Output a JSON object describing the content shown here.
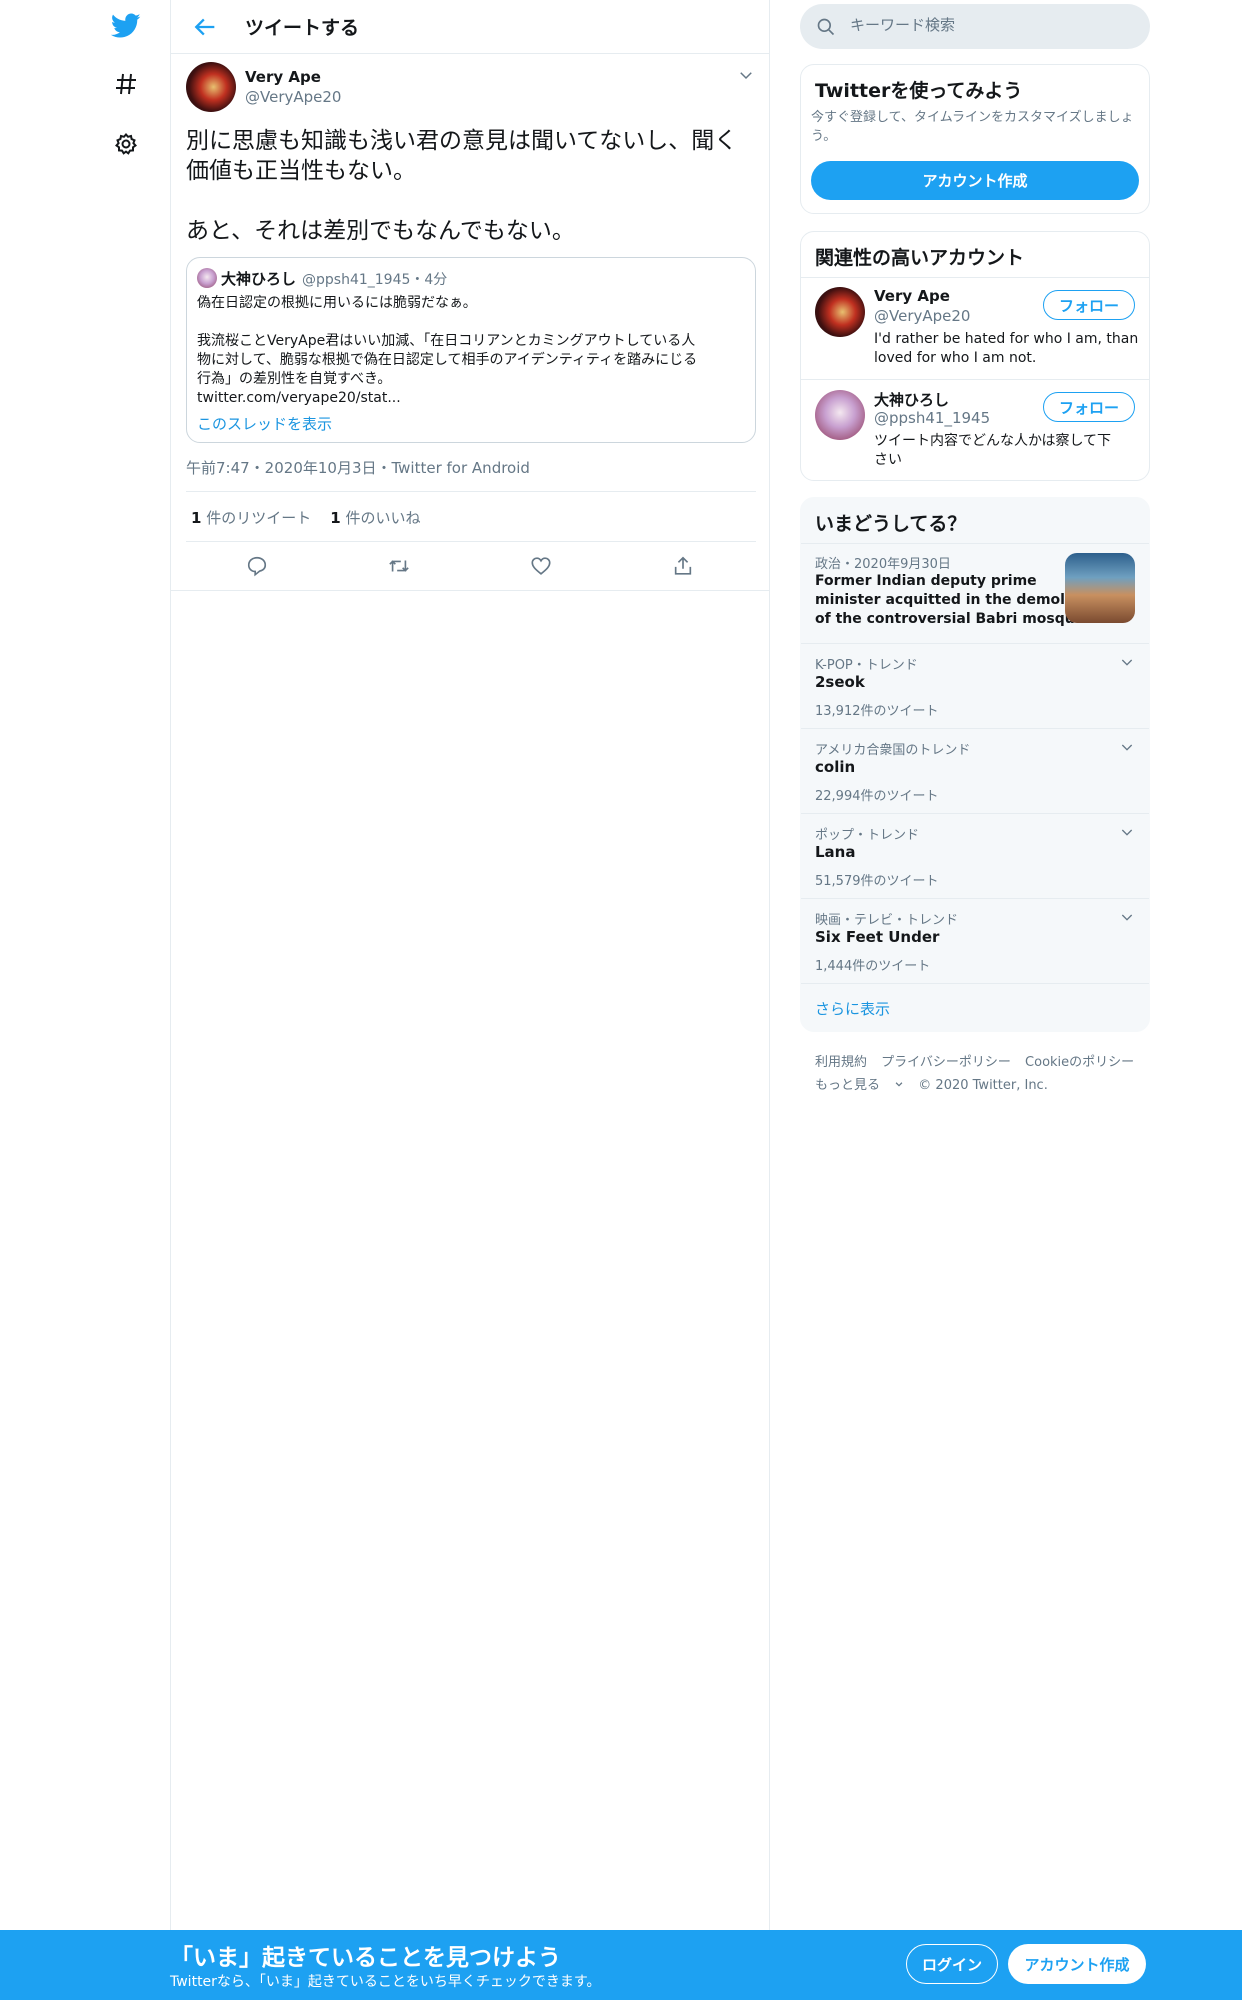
{
  "nav": {
    "logo_icon": "twitter-bird-icon",
    "explore_icon": "hashtag-icon",
    "settings_icon": "gear-icon"
  },
  "header": {
    "title": "ツイートする"
  },
  "tweet": {
    "author_name": "Very Ape",
    "author_handle": "@VeryApe20",
    "text_lines": [
      "別に思慮も知識も浅い君の意見は聞いてないし、聞く",
      "価値も正当性もない。",
      "",
      "あと、それは差別でもなんでもない。"
    ],
    "meta": "午前7:47・2020年10月3日・Twitter for Android",
    "retweet_count": "1",
    "retweet_label": " 件のリツイート",
    "like_count": "1",
    "like_label": " 件のいいね"
  },
  "quote": {
    "name": "大神ひろし",
    "meta": "@ppsh41_1945・4分",
    "lines": [
      "偽在日認定の根拠に用いるには脆弱だなぁ。",
      "",
      "我流桜ことVeryApe君はいい加減、「在日コリアンとカミングアウトしている人",
      "物に対して、脆弱な根拠で偽在日認定して相手のアイデンティティを踏みにじる",
      "行為」の差別性を自覚すべき。",
      "twitter.com/veryape20/stat..."
    ],
    "thread_link": "このスレッドを表示"
  },
  "search": {
    "placeholder": "キーワード検索"
  },
  "signup_card": {
    "title": "Twitterを使ってみよう",
    "desc_line1": "今すぐ登録して、タイムラインをカスタマイズしましょ",
    "desc_line2": "う。",
    "button": "アカウント作成"
  },
  "related": {
    "title": "関連性の高いアカウント",
    "accounts": [
      {
        "name": "Very Ape",
        "handle": "@VeryApe20",
        "follow": "フォロー",
        "bio_line1": "I'd rather be hated for who I am, than",
        "bio_line2": "loved for who I am not."
      },
      {
        "name": "大神ひろし",
        "handle": "@ppsh41_1945",
        "follow": "フォロー",
        "bio_line1": "ツイート内容でどんな人かは察して下",
        "bio_line2": "さい"
      }
    ]
  },
  "trends": {
    "title": "いまどうしてる？",
    "news": {
      "category": "政治・2020年9月30日",
      "line1": "Former Indian deputy prime",
      "line2": "minister acquitted in the demolition",
      "line3": "of the controversial Babri mosque"
    },
    "items": [
      {
        "category": "K-POP・トレンド",
        "name": "2seok",
        "count": "13,912件のツイート"
      },
      {
        "category": "アメリカ合衆国のトレンド",
        "name": "colin",
        "count": "22,994件のツイート"
      },
      {
        "category": "ポップ・トレンド",
        "name": "Lana",
        "count": "51,579件のツイート"
      },
      {
        "category": "映画・テレビ・トレンド",
        "name": "Six Feet Under",
        "count": "1,444件のツイート"
      }
    ],
    "show_more": "さらに表示"
  },
  "footer": {
    "terms": "利用規約",
    "privacy": "プライバシーポリシー",
    "cookie": "Cookieのポリシー",
    "more": "もっと見る",
    "copyright": "© 2020 Twitter, Inc."
  },
  "bottom_bar": {
    "title": "「いま」起きていることを見つけよう",
    "subtitle": "Twitterなら、「いま」起きていることをいち早くチェックできます。",
    "login": "ログイン",
    "signup": "アカウント作成"
  },
  "colors": {
    "accent": "#1da1f2",
    "text": "#14171a",
    "muted": "#657786",
    "border": "#e6ecf0"
  }
}
